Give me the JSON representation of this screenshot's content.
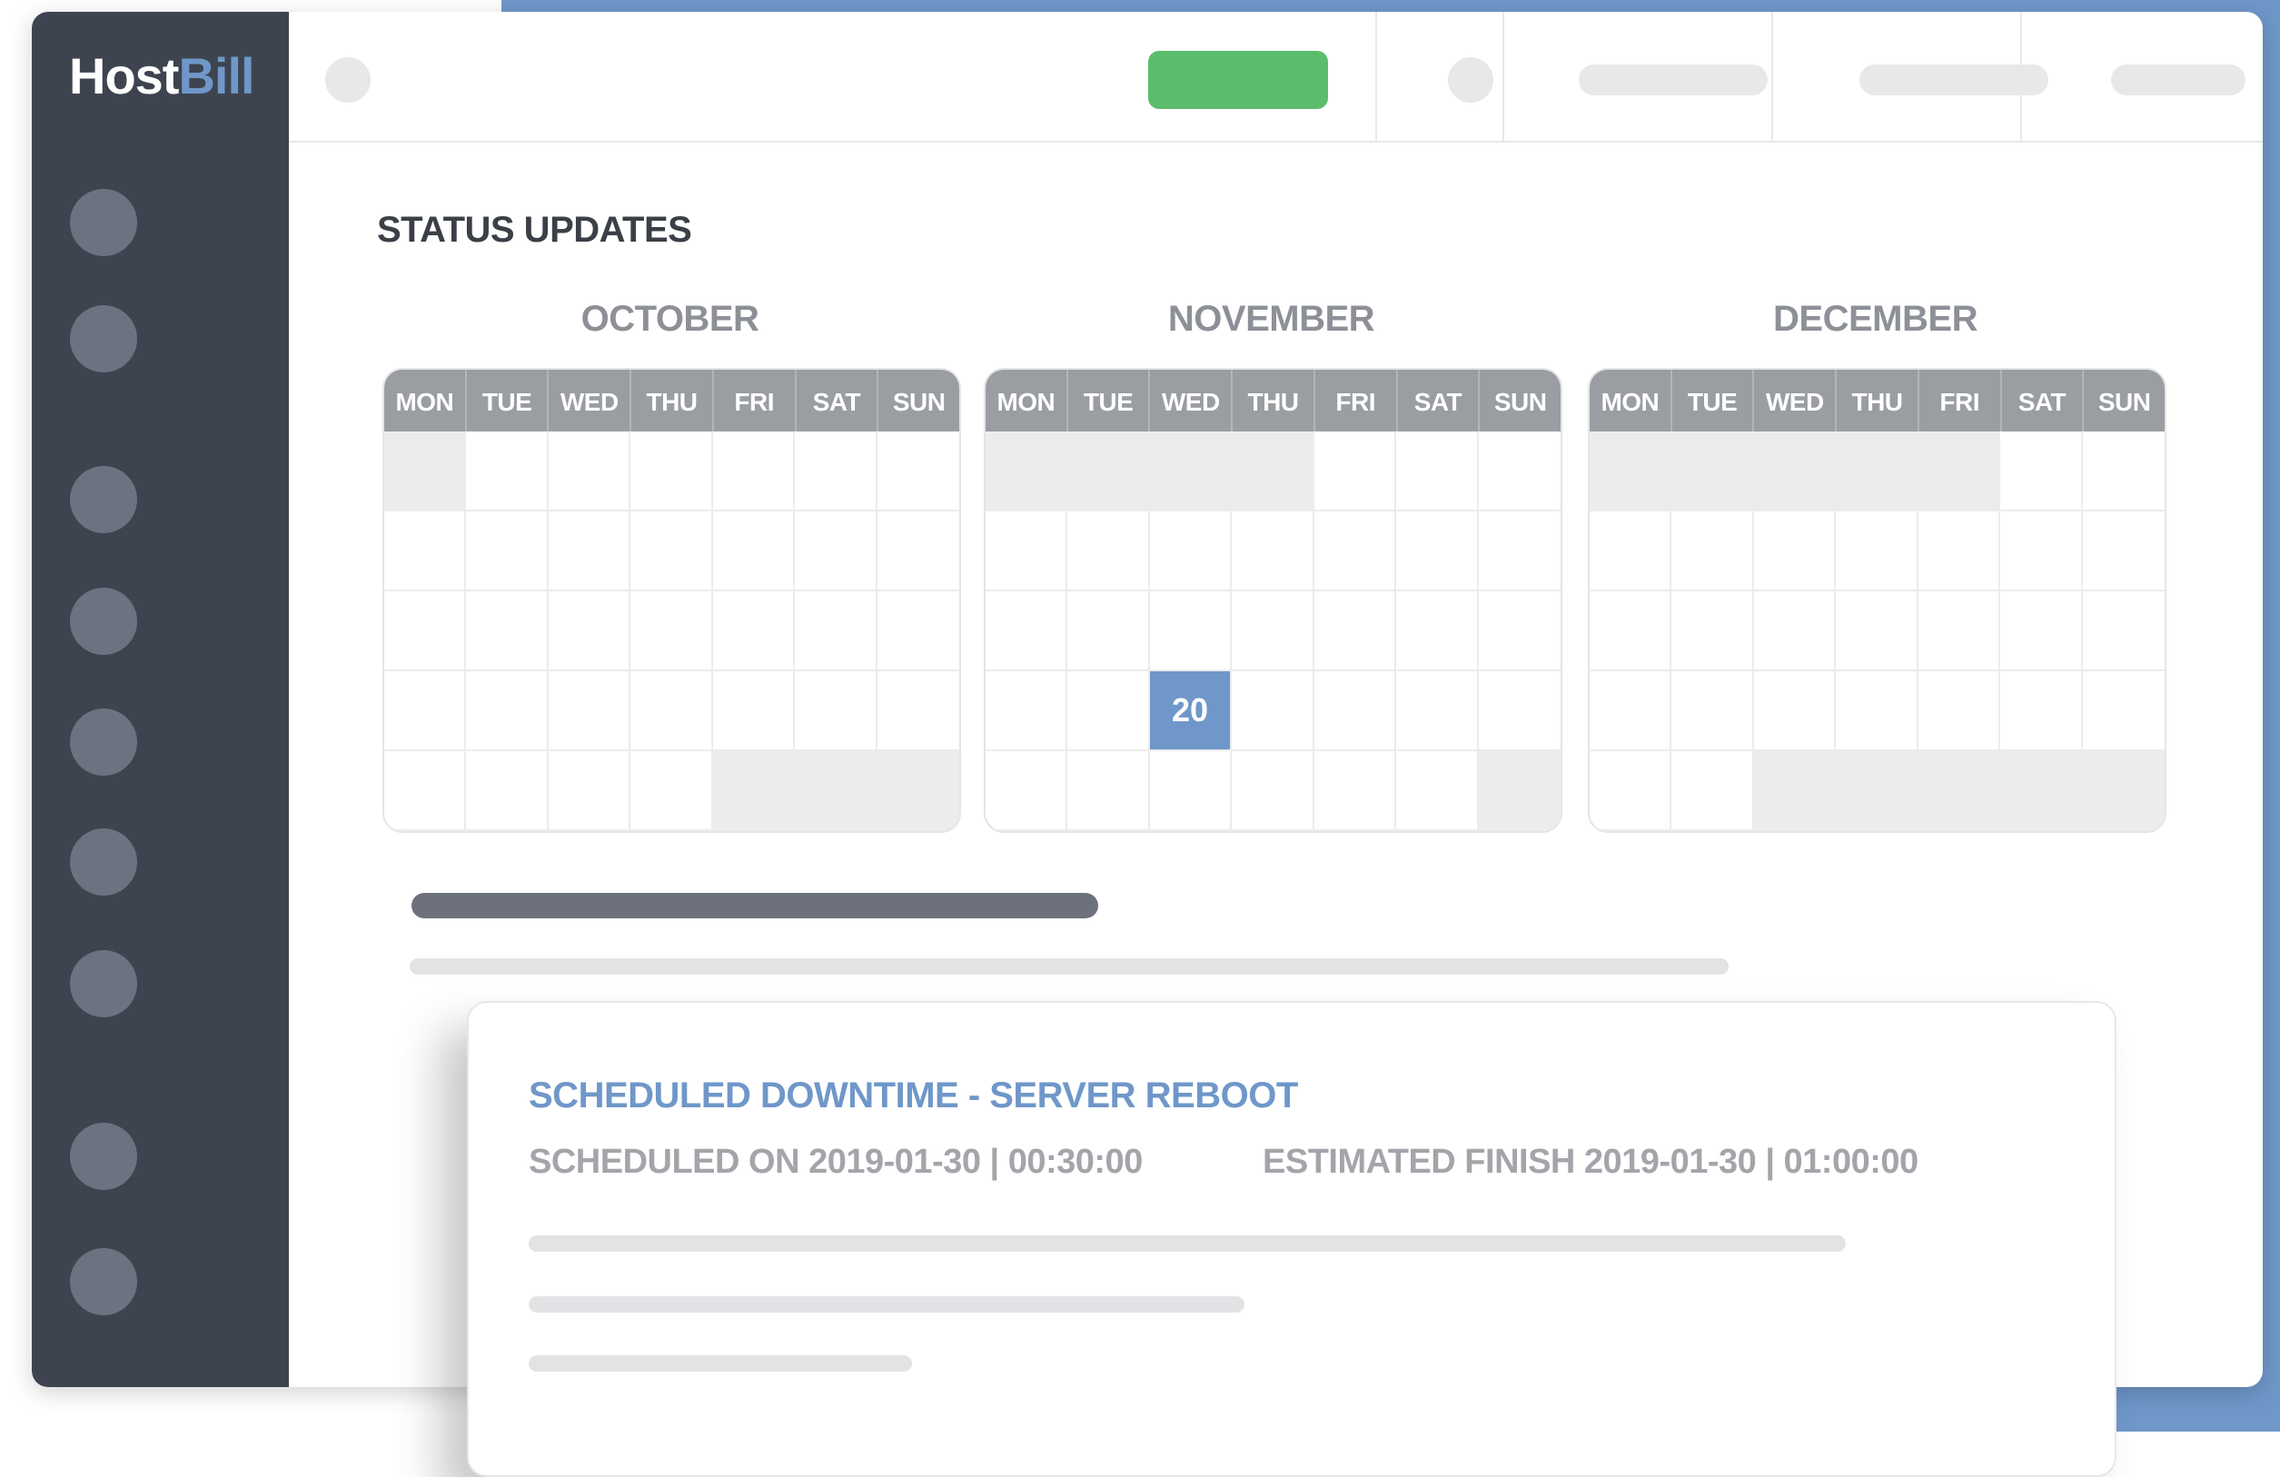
{
  "brand": {
    "logo_part1": "Host",
    "logo_part2": "Bill"
  },
  "page": {
    "section_title": "STATUS UPDATES"
  },
  "calendars": [
    {
      "month": "OCTOBER",
      "weekdays": [
        "MON",
        "TUE",
        "WED",
        "THU",
        "FRI",
        "SAT",
        "SUN"
      ],
      "outside_cells": [
        0,
        32,
        33,
        34
      ],
      "selected": null
    },
    {
      "month": "NOVEMBER",
      "weekdays": [
        "MON",
        "TUE",
        "WED",
        "THU",
        "FRI",
        "SAT",
        "SUN"
      ],
      "outside_cells": [
        0,
        1,
        2,
        3,
        34
      ],
      "selected": {
        "cell": 23,
        "label": "20"
      }
    },
    {
      "month": "DECEMBER",
      "weekdays": [
        "MON",
        "TUE",
        "WED",
        "THU",
        "FRI",
        "SAT",
        "SUN"
      ],
      "outside_cells": [
        0,
        1,
        2,
        3,
        4,
        30,
        31,
        32,
        33,
        34
      ],
      "selected": null
    }
  ],
  "event": {
    "title": "SCHEDULED DOWNTIME - SERVER REBOOT",
    "scheduled": "SCHEDULED ON 2019-01-30 | 00:30:00",
    "estimated": "ESTIMATED FINISH 2019-01-30 | 01:00:00"
  },
  "colors": {
    "sidebar": "#3e444f",
    "accent_blue": "#6f97c9",
    "action_green": "#5bbd6b",
    "calendar_header": "#9a9da2",
    "outside_day": "#ebeced"
  }
}
